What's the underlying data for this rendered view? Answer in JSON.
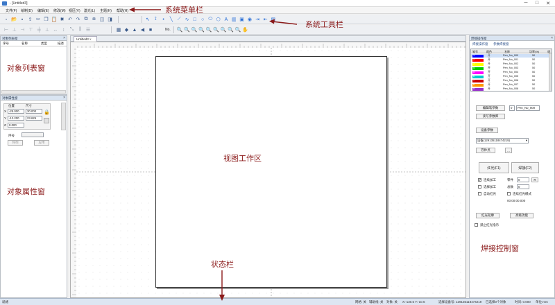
{
  "window": {
    "title": "- [Untitled3]",
    "minimize": "─",
    "maximize": "□",
    "close": "✕"
  },
  "menu": {
    "items": [
      "文件(F)",
      "绘制(D)",
      "编辑(E)",
      "修改(M)",
      "视区(V)",
      "激光(L)",
      "主题(H)",
      "帮助(H)"
    ]
  },
  "toolbar": {
    "row1_icons": [
      "new-icon",
      "open-icon",
      "save-icon",
      "export-icon",
      "cut-icon",
      "copy-icon",
      "paste-icon",
      "delete-icon",
      "undo-icon",
      "redo-icon",
      "group-icon",
      "ungroup-icon",
      "combine-icon",
      "split-icon",
      "select-icon",
      "node-edit-icon",
      "point-icon",
      "line-icon",
      "polyline-icon",
      "curve-icon",
      "rectangle-icon",
      "circle-icon",
      "ellipse-icon",
      "polygon-icon",
      "text-icon",
      "barcode-icon",
      "image-icon",
      "vector-icon",
      "inputport-icon",
      "outputport-icon",
      "hatch-icon"
    ],
    "row2_icons": [
      "align-left-icon",
      "align-center-icon",
      "align-right-icon",
      "align-top-icon",
      "align-middle-icon",
      "align-bottom-icon",
      "same-width-icon",
      "same-height-icon",
      "same-size-icon",
      "distribute-h-icon",
      "distribute-v-icon",
      "grid-icon",
      "color-icon",
      "mirror-h-icon",
      "mirror-v-icon",
      "rotate-icon"
    ],
    "row2_label": "No.",
    "zoom_icons": [
      "zoom-in-icon",
      "zoom-out-icon",
      "zoom-fit-icon",
      "zoom-select-icon",
      "zoom-all-icon",
      "zoom-page-icon",
      "zoom-prev-icon",
      "zoom-real-icon",
      "zoom-custom-icon",
      "pan-icon"
    ]
  },
  "object_list": {
    "title": "对象列表窗",
    "columns": [
      "序号",
      "名称",
      "类型",
      "描述"
    ]
  },
  "object_props": {
    "title": "对象属性窗",
    "group_pos": "位置",
    "group_size": "尺寸",
    "x_label": "X",
    "y_label": "Y",
    "z_label": "Z",
    "x_pos": "-25.000",
    "x_size": "30.000",
    "y_pos": "-12.200",
    "y_size": "23.625",
    "z_pos": "0.000",
    "seq_label": "序号",
    "seq_value": "",
    "btn_array": "阵列",
    "btn_apply": "应用"
  },
  "document": {
    "tab_label": "Untitled3"
  },
  "weld": {
    "title": "焊接操作窗",
    "tab_outside": "焊接操作窗",
    "tab_params": "参数焊接窗",
    "pen_columns": [
      "笔号",
      "颜色",
      "名称",
      "功率(%)",
      "速"
    ],
    "pens": [
      {
        "no": "1",
        "color": "#0000ff",
        "mode": "开",
        "name": "Pen_No_000",
        "power": "50"
      },
      {
        "no": "2",
        "color": "#ff0000",
        "mode": "开",
        "name": "Pen_No_001",
        "power": "50"
      },
      {
        "no": "3",
        "color": "#ffff00",
        "mode": "开",
        "name": "Pen_No_002",
        "power": "50"
      },
      {
        "no": "4",
        "color": "#00cc00",
        "mode": "开",
        "name": "Pen_No_003",
        "power": "50"
      },
      {
        "no": "5",
        "color": "#ff00ff",
        "mode": "开",
        "name": "Pen_No_004",
        "power": "50"
      },
      {
        "no": "6",
        "color": "#00cccc",
        "mode": "开",
        "name": "Pen_No_005",
        "power": "50"
      },
      {
        "no": "7",
        "color": "#cc0000",
        "mode": "开",
        "name": "Pen_No_006",
        "power": "50"
      },
      {
        "no": "8",
        "color": "#ff9900",
        "mode": "开",
        "name": "Pen_No_007",
        "power": "50"
      },
      {
        "no": "9",
        "color": "#9933cc",
        "mode": "开",
        "name": "Pen_No_008",
        "power": "50"
      }
    ],
    "btn_edit_params": "编辑笔参数",
    "pen_index": "0",
    "pen_name_value": "Pen_No_000",
    "btn_param_lib": "读写参数库",
    "btn_device": "设备参数",
    "device_select": "设备(129135118474219)",
    "btn_save": "存贮点",
    "btn_more": "...",
    "btn_red": "红光(F1)",
    "btn_weld": "焊接(F2)",
    "chk_continuous": "连续加工",
    "chk_continuous_checked": "✔",
    "lbl_parts": "零件",
    "parts_value": "0",
    "btn_reset": "R",
    "chk_select": "选择加工",
    "lbl_total": "总数",
    "total_value": "0",
    "chk_auto": "自动红光",
    "chk_continuous_red": "连续红光模式",
    "timer": "00:00:00.000",
    "btn_red_outline": "红光轮廓",
    "btn_advanced": "高级功能",
    "chk_follow": "禁止红光指示"
  },
  "status": {
    "left": "就绪",
    "grid": "网格: 关",
    "guide": "辅助线: 关",
    "snap": "对象: 关",
    "coords": "X:-130.5 Y:-10.6",
    "device": "选择设备号: 129135118474219",
    "info": "已选择0个对象",
    "speed": "时间: 0.000",
    "units": "单位:mm"
  },
  "annotations": {
    "menu": "系统菜单栏",
    "toolbar": "系统工具栏",
    "object_list": "对象列表窗",
    "view": "视图工作区",
    "object_props": "对象属性窗",
    "status": "状态栏",
    "weld": "焊接控制窗"
  },
  "colors": {
    "annotation": "#8b1a1a",
    "panel_header": "#d9e4f1",
    "accent": "#2a6fd6"
  }
}
